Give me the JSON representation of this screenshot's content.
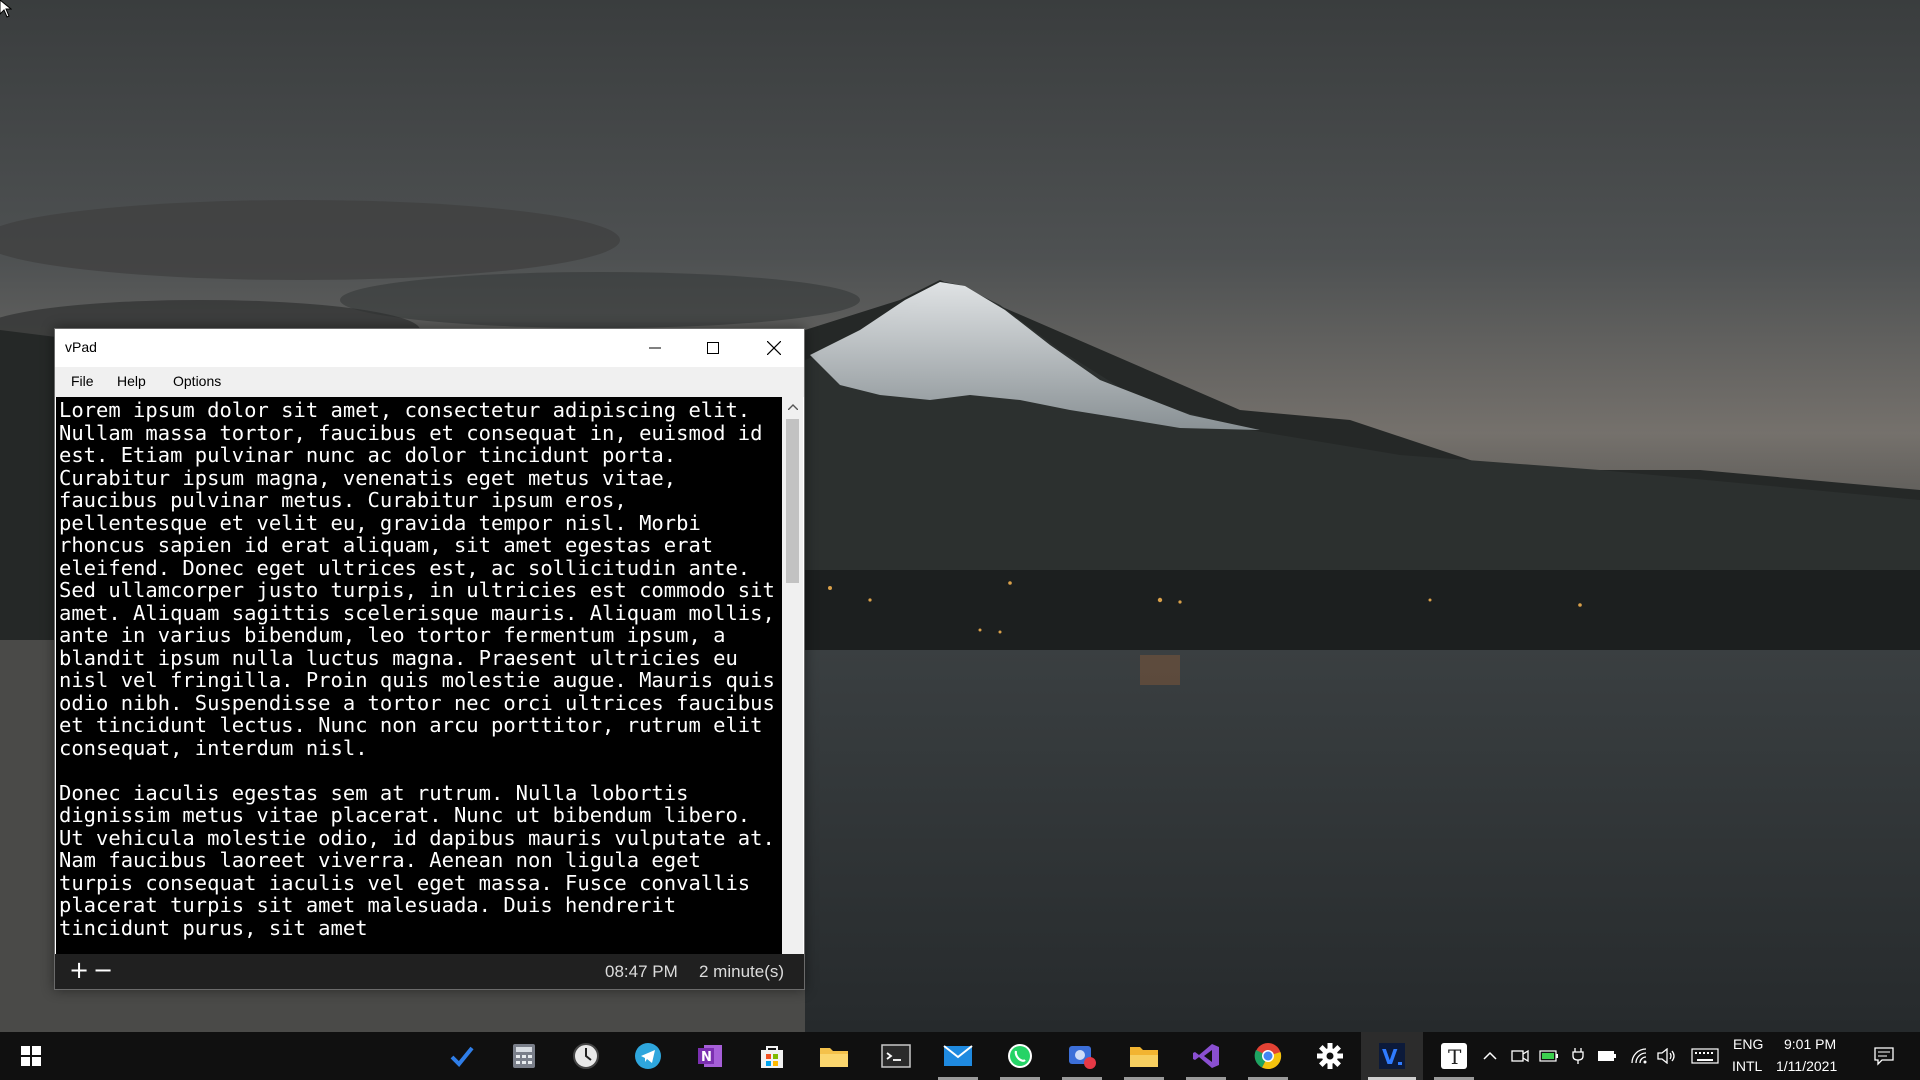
{
  "window": {
    "title": "vPad",
    "menu": [
      "File",
      "Help",
      "Options"
    ],
    "editor_text": "Lorem ipsum dolor sit amet, consectetur adipiscing elit. Nullam massa tortor, faucibus et consequat in, euismod id est. Etiam pulvinar nunc ac dolor tincidunt porta. Curabitur ipsum magna, venenatis eget metus vitae, faucibus pulvinar metus. Curabitur ipsum eros, pellentesque et velit eu, gravida tempor nisl. Morbi rhoncus sapien id erat aliquam, sit amet egestas erat eleifend. Donec eget ultrices est, ac sollicitudin ante. Sed ullamcorper justo turpis, in ultricies est commodo sit amet. Aliquam sagittis scelerisque mauris. Aliquam mollis, ante in varius bibendum, leo tortor fermentum ipsum, a blandit ipsum nulla luctus magna. Praesent ultricies eu nisl vel fringilla. Proin quis molestie augue. Mauris quis odio nibh. Suspendisse a tortor nec orci ultrices faucibus et tincidunt lectus. Nunc non arcu porttitor, rutrum elit consequat, interdum nisl.\n\nDonec iaculis egestas sem at rutrum. Nulla lobortis dignissim metus vitae placerat. Nunc ut bibendum libero. Ut vehicula molestie odio, id dapibus mauris vulputate at. Nam faucibus laoreet viverra. Aenean non ligula eget turpis consequat iaculis vel eget massa. Fusce convallis placerat turpis sit amet malesuada. Duis hendrerit tincidunt purus, sit amet",
    "status": {
      "zoom_in": "+",
      "zoom_out": "−",
      "time": "08:47 PM",
      "duration": "2 minute(s)"
    }
  },
  "taskbar": {
    "apps": [
      {
        "name": "To Do",
        "icon": "checkmark-icon",
        "color": "#2f7ee8"
      },
      {
        "name": "Calculator",
        "icon": "calculator-icon",
        "color": "#7a7f8a"
      },
      {
        "name": "Clock",
        "icon": "clock-icon",
        "color": "#e8e8e8"
      },
      {
        "name": "Telegram",
        "icon": "telegram-icon",
        "color": "#2ea6dd"
      },
      {
        "name": "OneNote",
        "icon": "onenote-icon",
        "color": "#7b2fb0"
      },
      {
        "name": "Microsoft Store",
        "icon": "store-icon",
        "color": "#f2f2f2"
      },
      {
        "name": "File Explorer",
        "icon": "folder-icon",
        "color": "#f4c14b"
      },
      {
        "name": "Terminal",
        "icon": "terminal-icon",
        "color": "#2a2a2a"
      },
      {
        "name": "Mail",
        "icon": "mail-icon",
        "color": "#1f8ae0"
      },
      {
        "name": "WhatsApp",
        "icon": "whatsapp-icon",
        "color": "#25d366"
      },
      {
        "name": "Screen Recorder",
        "icon": "recorder-icon",
        "color": "#3c6fd9"
      },
      {
        "name": "Files",
        "icon": "files-icon",
        "color": "#f2b431"
      },
      {
        "name": "Visual Studio",
        "icon": "visual-studio-icon",
        "color": "#8a4fd1"
      },
      {
        "name": "Chrome",
        "icon": "chrome-icon",
        "color": "#e34234"
      },
      {
        "name": "Settings",
        "icon": "gear-icon",
        "color": "#ffffff"
      },
      {
        "name": "vPad",
        "icon": "vpad-icon",
        "color": "#1c5fd6"
      },
      {
        "name": "Typora",
        "icon": "typora-icon",
        "color": "#ffffff"
      }
    ],
    "tray": {
      "lang_line1": "ENG",
      "lang_line2": "INTL",
      "time": "9:01 PM",
      "date": "1/11/2021"
    }
  }
}
